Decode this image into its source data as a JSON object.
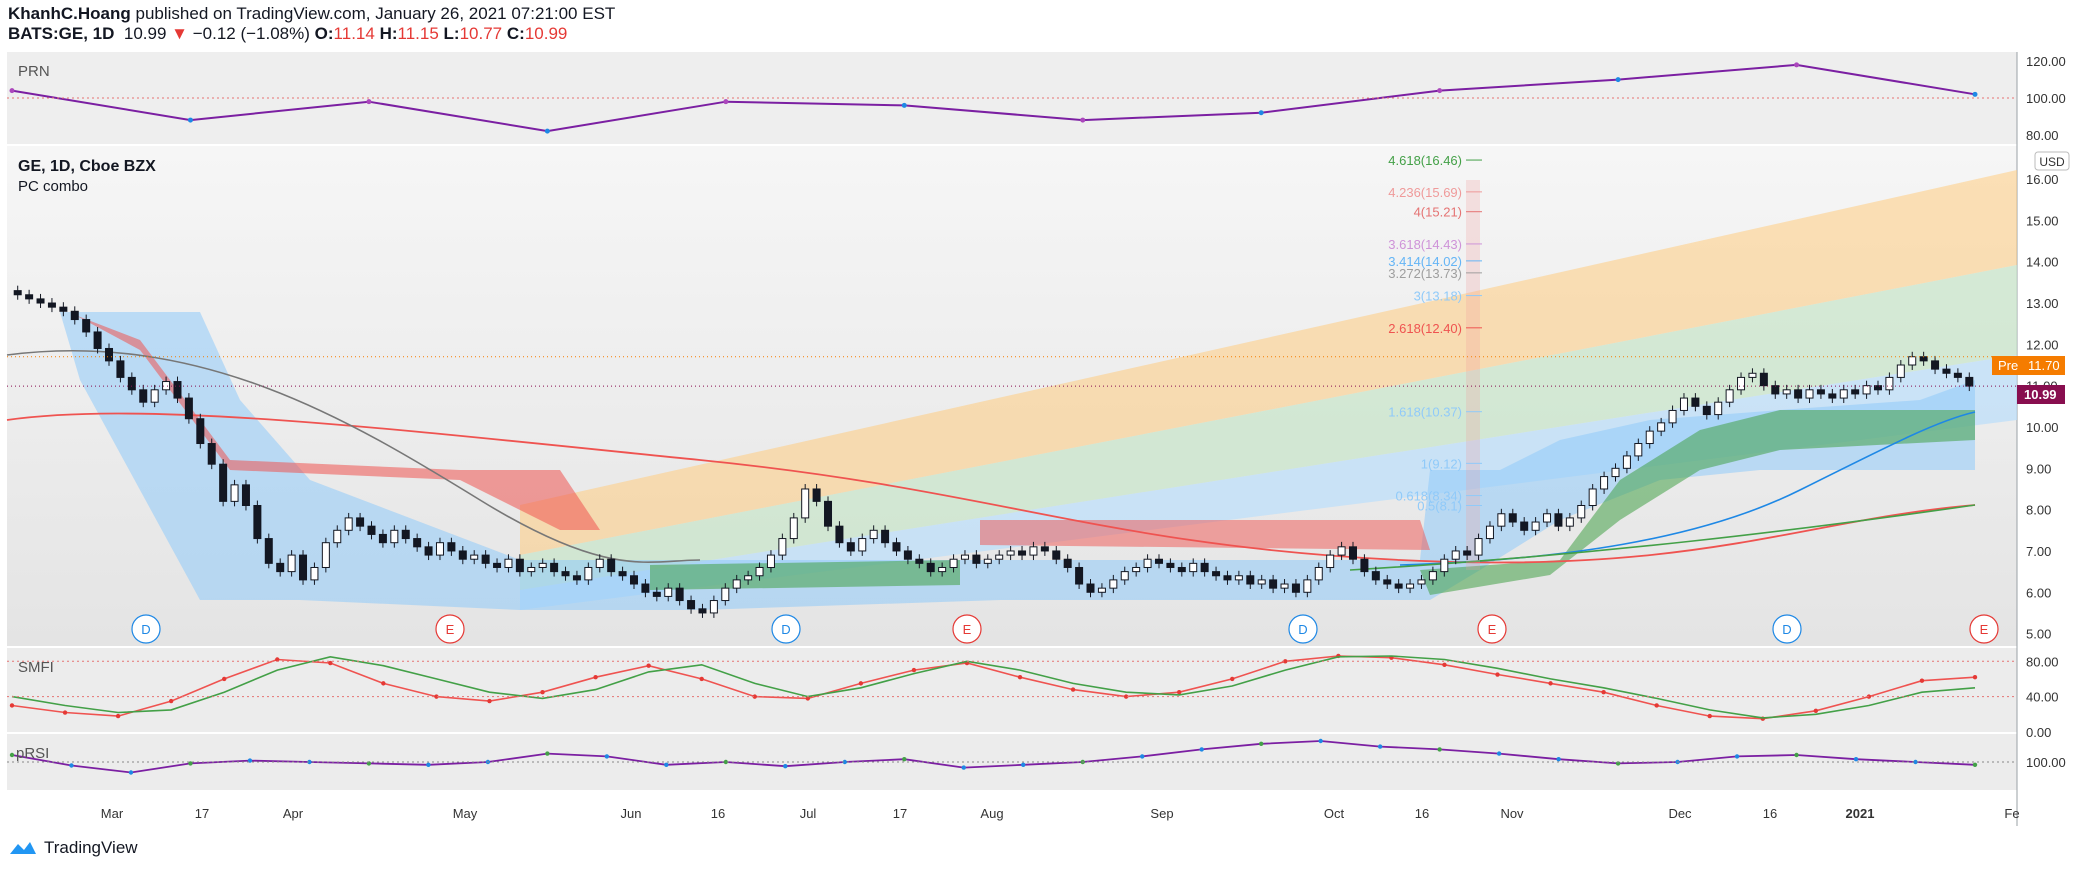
{
  "header": {
    "author": "KhanhC.Hoang",
    "published_text": " published on TradingView.com, January 26, 2021 07:21:00 EST",
    "symbol": "BATS:GE, 1D",
    "last": "10.99",
    "arrow": "▼",
    "change": "−0.12 (−1.08%)",
    "o_label": "O:",
    "o_val": "11.14",
    "h_label": "H:",
    "h_val": "11.15",
    "l_label": "L:",
    "l_val": "10.77",
    "c_label": "C:",
    "c_val": "10.99"
  },
  "panes": {
    "prn_title": "PRN",
    "main_title": "GE, 1D, Cboe BZX",
    "main_subtitle": "PC combo",
    "smfi_title": "SMFI",
    "prsi_title": "pRSI",
    "currency": "USD"
  },
  "footer": {
    "brand": "TradingView"
  },
  "colors": {
    "up": "#ffffff",
    "down": "#131722",
    "price_tag": "#880e4f",
    "pre_tag": "#f57c00",
    "red_band": "#ef5350",
    "green_band": "#43a047",
    "blue_band": "#90caf9",
    "orange_fan": "#ffcc80"
  },
  "chart_data": [
    {
      "name": "PRN",
      "type": "line",
      "y_ticks": [
        "120.00",
        "100.00",
        "80.00"
      ],
      "ylim": [
        75,
        125
      ],
      "x": [
        "Feb",
        "Mar",
        "Apr",
        "May",
        "Jun",
        "Jul",
        "Aug",
        "Sep",
        "Oct",
        "Nov",
        "Dec",
        "2021"
      ],
      "values": [
        104,
        88,
        98,
        82,
        98,
        96,
        88,
        92,
        104,
        110,
        118,
        102
      ]
    },
    {
      "name": "GE, 1D, Cboe BZX",
      "type": "candlestick",
      "y_ticks": [
        "16.00",
        "15.00",
        "14.00",
        "13.00",
        "12.00",
        "11.00",
        "10.00",
        "9.00",
        "8.00",
        "7.00",
        "6.00",
        "5.00"
      ],
      "ylim": [
        4.7,
        16.8
      ],
      "x_ticks": [
        "Mar",
        "17",
        "Apr",
        "May",
        "Jun",
        "16",
        "Jul",
        "17",
        "Aug",
        "Sep",
        "Oct",
        "16",
        "Nov",
        "Dec",
        "16",
        "2021",
        "Fe"
      ],
      "last_price_label": "10.99",
      "pre_label": "Pre",
      "pre_price": "11.70",
      "fib_levels": [
        {
          "label": "4.618(16.46)",
          "value": 16.46,
          "color": "#43a047"
        },
        {
          "label": "4.236(15.69)",
          "value": 15.69,
          "color": "#ef9a9a"
        },
        {
          "label": "4(15.21)",
          "value": 15.21,
          "color": "#e57373"
        },
        {
          "label": "3.618(14.43)",
          "value": 14.43,
          "color": "#ce93d8"
        },
        {
          "label": "3.414(14.02)",
          "value": 14.02,
          "color": "#64b5f6"
        },
        {
          "label": "3.272(13.73)",
          "value": 13.73,
          "color": "#9e9e9e"
        },
        {
          "label": "3(13.18)",
          "value": 13.18,
          "color": "#90caf9"
        },
        {
          "label": "2.618(12.40)",
          "value": 12.4,
          "color": "#ef5350"
        },
        {
          "label": "1.618(10.37)",
          "value": 10.37,
          "color": "#90caf9"
        },
        {
          "label": "1(9.12)",
          "value": 9.12,
          "color": "#90caf9"
        },
        {
          "label": "0.618(8.34)",
          "value": 8.34,
          "color": "#90caf9"
        },
        {
          "label": "0.5(8.1)",
          "value": 8.1,
          "color": "#90caf9"
        }
      ],
      "events": [
        "D",
        "E",
        "D",
        "E",
        "D",
        "E",
        "D",
        "E"
      ],
      "close": [
        13.2,
        13.1,
        13.0,
        12.9,
        12.8,
        12.6,
        12.3,
        11.9,
        11.6,
        11.2,
        10.9,
        10.6,
        10.9,
        11.1,
        10.7,
        10.2,
        9.6,
        9.1,
        8.2,
        8.6,
        8.1,
        7.3,
        6.7,
        6.5,
        6.9,
        6.3,
        6.6,
        7.2,
        7.5,
        7.8,
        7.6,
        7.4,
        7.2,
        7.5,
        7.3,
        7.1,
        6.9,
        7.2,
        7.0,
        6.8,
        6.9,
        6.7,
        6.6,
        6.8,
        6.5,
        6.6,
        6.7,
        6.5,
        6.4,
        6.3,
        6.6,
        6.8,
        6.5,
        6.4,
        6.2,
        6.0,
        5.9,
        6.1,
        5.8,
        5.6,
        5.5,
        5.8,
        6.1,
        6.3,
        6.4,
        6.6,
        6.9,
        7.3,
        7.8,
        8.5,
        8.2,
        7.6,
        7.2,
        7.0,
        7.3,
        7.5,
        7.2,
        7.0,
        6.8,
        6.7,
        6.5,
        6.6,
        6.8,
        6.9,
        6.7,
        6.8,
        6.9,
        7.0,
        6.9,
        7.1,
        7.0,
        6.8,
        6.6,
        6.2,
        6.0,
        6.1,
        6.3,
        6.5,
        6.6,
        6.8,
        6.7,
        6.6,
        6.5,
        6.7,
        6.5,
        6.4,
        6.3,
        6.4,
        6.2,
        6.3,
        6.1,
        6.2,
        6.0,
        6.3,
        6.6,
        6.9,
        7.1,
        6.8,
        6.5,
        6.3,
        6.2,
        6.1,
        6.2,
        6.3,
        6.5,
        6.8,
        7.0,
        6.9,
        7.3,
        7.6,
        7.9,
        7.7,
        7.5,
        7.7,
        7.9,
        7.6,
        7.8,
        8.1,
        8.5,
        8.8,
        9.0,
        9.3,
        9.6,
        9.9,
        10.1,
        10.4,
        10.7,
        10.5,
        10.3,
        10.6,
        10.9,
        11.2,
        11.3,
        11.0,
        10.8,
        10.9,
        10.7,
        10.9,
        10.8,
        10.7,
        10.9,
        10.8,
        11.0,
        10.9,
        11.2,
        11.5,
        11.7,
        11.6,
        11.4,
        11.3,
        11.2,
        10.99
      ]
    },
    {
      "name": "SMFI",
      "type": "line",
      "y_ticks": [
        "80.00",
        "40.00",
        "0.00"
      ],
      "ylim": [
        0,
        95
      ],
      "series": [
        {
          "values": [
            30,
            22,
            18,
            35,
            60,
            82,
            78,
            55,
            40,
            35,
            45,
            62,
            75,
            60,
            40,
            38,
            55,
            70,
            78,
            62,
            48,
            40,
            45,
            60,
            80,
            86,
            84,
            76,
            65,
            55,
            45,
            30,
            18,
            15,
            24,
            40,
            58,
            62
          ]
        },
        {
          "values": [
            40,
            30,
            22,
            25,
            45,
            70,
            85,
            75,
            60,
            45,
            38,
            48,
            68,
            76,
            55,
            40,
            50,
            66,
            80,
            70,
            55,
            45,
            42,
            52,
            70,
            85,
            86,
            82,
            72,
            60,
            50,
            38,
            25,
            16,
            20,
            30,
            45,
            50
          ]
        }
      ]
    },
    {
      "name": "pRSI",
      "type": "line",
      "y_ticks": [
        "100.00"
      ],
      "ylim": [
        60,
        140
      ],
      "values": [
        110,
        95,
        85,
        98,
        102,
        100,
        98,
        96,
        100,
        112,
        108,
        96,
        100,
        94,
        100,
        104,
        92,
        96,
        100,
        108,
        118,
        126,
        130,
        122,
        118,
        112,
        104,
        98,
        100,
        108,
        110,
        104,
        100,
        96
      ]
    }
  ]
}
